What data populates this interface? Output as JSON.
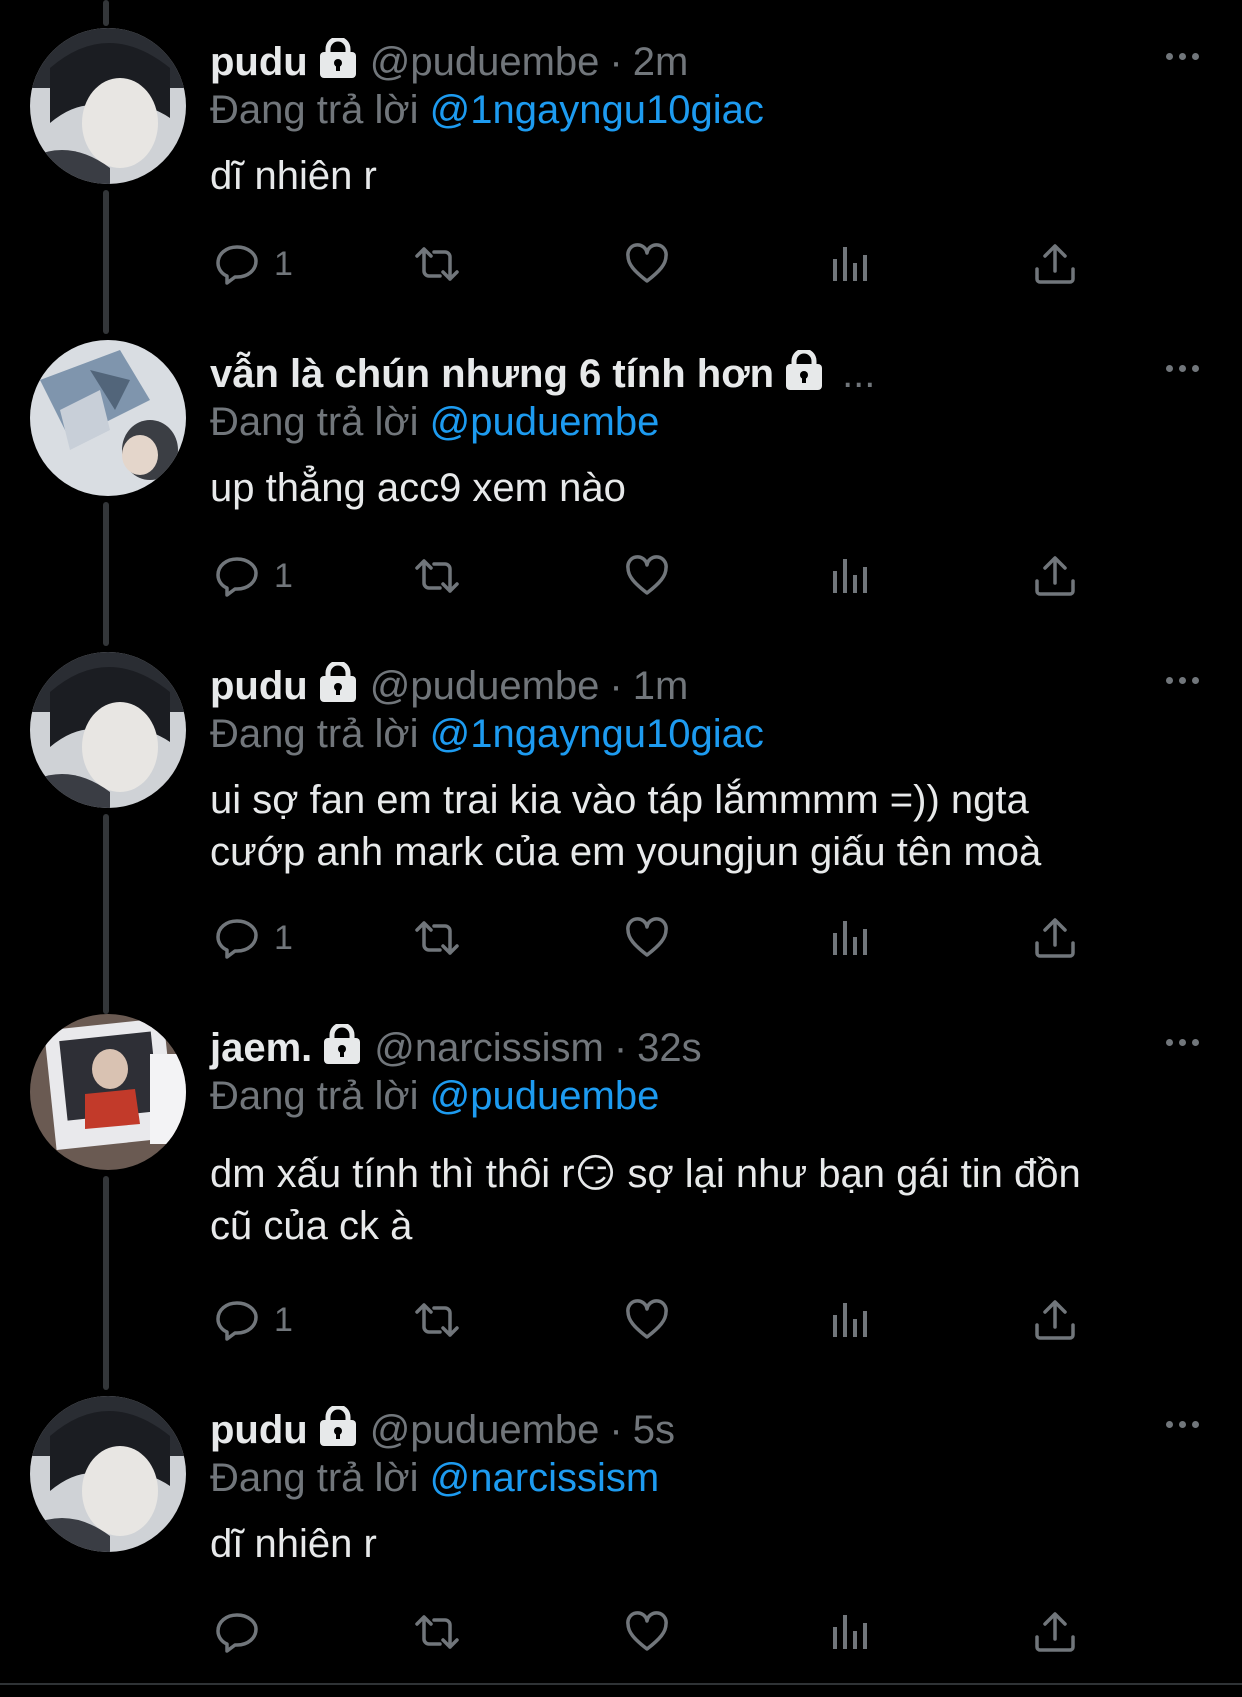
{
  "colors": {
    "background": "#000000",
    "text": "#e7e9ea",
    "secondary": "#71767b",
    "link": "#1d9bf0",
    "thread": "#333639"
  },
  "icons": {
    "lock": "lock-icon",
    "more": "more-options-icon",
    "reply": "reply-icon",
    "retweet": "retweet-icon",
    "like": "like-icon",
    "views": "views-icon",
    "share": "share-icon"
  },
  "tweets": [
    {
      "name": "pudu",
      "handle": "@pudu​embe",
      "dot": "·",
      "time": "2m",
      "reply_prefix": "Đang trả lời",
      "reply_to": "@1ngayngu10giac",
      "body": "dĩ nhiên r",
      "reply_count": "1"
    },
    {
      "name": "vẫn là chún nhưng 6 tính hơn",
      "handle": "",
      "dot": "",
      "time": "",
      "ellipsis": "...",
      "reply_prefix": "Đang trả lời",
      "reply_to": "@puduembe",
      "body": "up thẳng acc9 xem nào",
      "reply_count": "1"
    },
    {
      "name": "pudu",
      "handle": "@puduembe",
      "dot": "·",
      "time": "1m",
      "reply_prefix": "Đang trả lời",
      "reply_to": "@1ngayngu10giac",
      "body_line1": "ui sợ fan em trai kia vào táp lắmmmm =)) ngta",
      "body_line2": "cướp anh mark của em youngjun giấu tên moà",
      "reply_count": "1"
    },
    {
      "name": "jaem.",
      "handle": "@narcissism",
      "dot": "·",
      "time": "32s",
      "reply_prefix": "Đang trả lời",
      "reply_to": "@puduembe",
      "body_line1": "dm xấu tính thì thôi r😏 sợ lại như bạn gái tin đồn",
      "body_line2": "cũ của ck à",
      "reply_count": "1"
    },
    {
      "name": "pudu",
      "handle": "@puduembe",
      "dot": "·",
      "time": "5s",
      "reply_prefix": "Đang trả lời",
      "reply_to": "@narcissism",
      "body": "dĩ nhiên r",
      "reply_count": ""
    }
  ]
}
